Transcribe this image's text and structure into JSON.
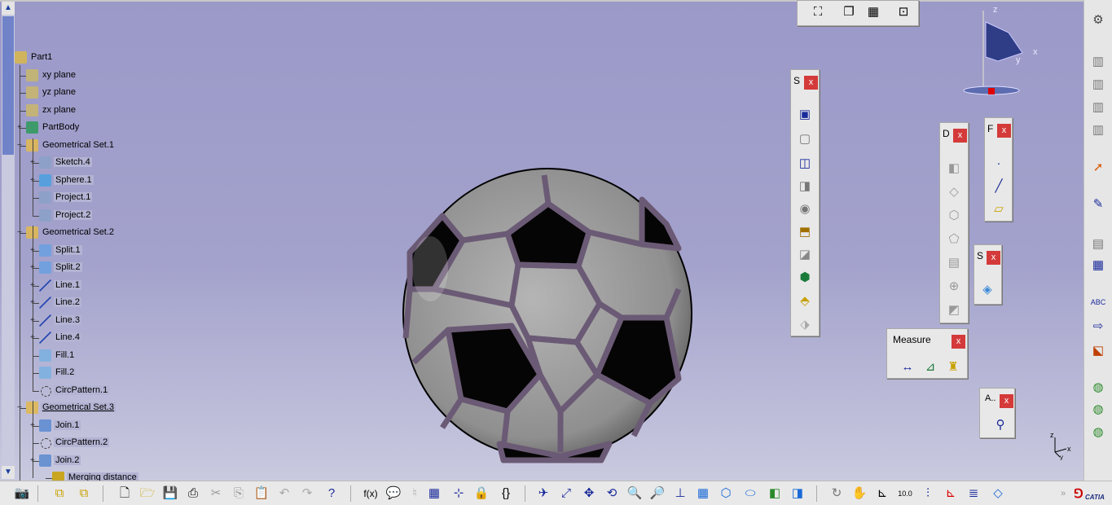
{
  "tree": {
    "root": "Part1",
    "items": [
      {
        "label": "xy plane",
        "type": "plane",
        "depth": 1
      },
      {
        "label": "yz plane",
        "type": "plane",
        "depth": 1
      },
      {
        "label": "zx plane",
        "type": "plane",
        "depth": 1
      },
      {
        "label": "PartBody",
        "type": "body",
        "depth": 1
      },
      {
        "label": "Geometrical Set.1",
        "type": "gset",
        "depth": 1
      },
      {
        "label": "Sketch.4",
        "type": "sketch",
        "depth": 2
      },
      {
        "label": "Sphere.1",
        "type": "sphere",
        "depth": 2
      },
      {
        "label": "Project.1",
        "type": "project",
        "depth": 2
      },
      {
        "label": "Project.2",
        "type": "project",
        "depth": 2
      },
      {
        "label": "Geometrical Set.2",
        "type": "gset",
        "depth": 1
      },
      {
        "label": "Split.1",
        "type": "split",
        "depth": 2
      },
      {
        "label": "Split.2",
        "type": "split",
        "depth": 2
      },
      {
        "label": "Line.1",
        "type": "line",
        "depth": 2
      },
      {
        "label": "Line.2",
        "type": "line",
        "depth": 2
      },
      {
        "label": "Line.3",
        "type": "line",
        "depth": 2
      },
      {
        "label": "Line.4",
        "type": "line",
        "depth": 2
      },
      {
        "label": "Fill.1",
        "type": "fill",
        "depth": 2
      },
      {
        "label": "Fill.2",
        "type": "fill",
        "depth": 2
      },
      {
        "label": "CircPattern.1",
        "type": "pattern",
        "depth": 2
      },
      {
        "label": "Geometrical Set.3",
        "type": "gset",
        "depth": 1
      },
      {
        "label": "Join.1",
        "type": "join",
        "depth": 2
      },
      {
        "label": "CircPattern.2",
        "type": "pattern",
        "depth": 2
      },
      {
        "label": "Join.2",
        "type": "join",
        "depth": 2
      },
      {
        "label": "Merging distance",
        "type": "param",
        "depth": 3
      }
    ]
  },
  "panels": {
    "sketch_tools": {
      "title": "S",
      "close": "x"
    },
    "dress_up": {
      "title": "D",
      "close": "x"
    },
    "wireframe": {
      "title": "F",
      "close": "x"
    },
    "surfaces": {
      "title": "S",
      "close": "x"
    },
    "measure": {
      "title": "Measure",
      "close": "x"
    },
    "analysis": {
      "title": "A..",
      "close": "x"
    }
  },
  "compass": {
    "z": "z",
    "y": "y",
    "x": "x"
  },
  "axis_triad": {
    "z": "z",
    "x": "x",
    "y": "y"
  },
  "brand": "CATIA",
  "colors": {
    "background_top": "#9b99c8",
    "background_bottom": "#c9c9df",
    "selection": "#b3b3d3",
    "close": "#d43a3a"
  },
  "bottom_toolbar": {
    "fx_label": "f(x)",
    "units_label": "10.0"
  }
}
